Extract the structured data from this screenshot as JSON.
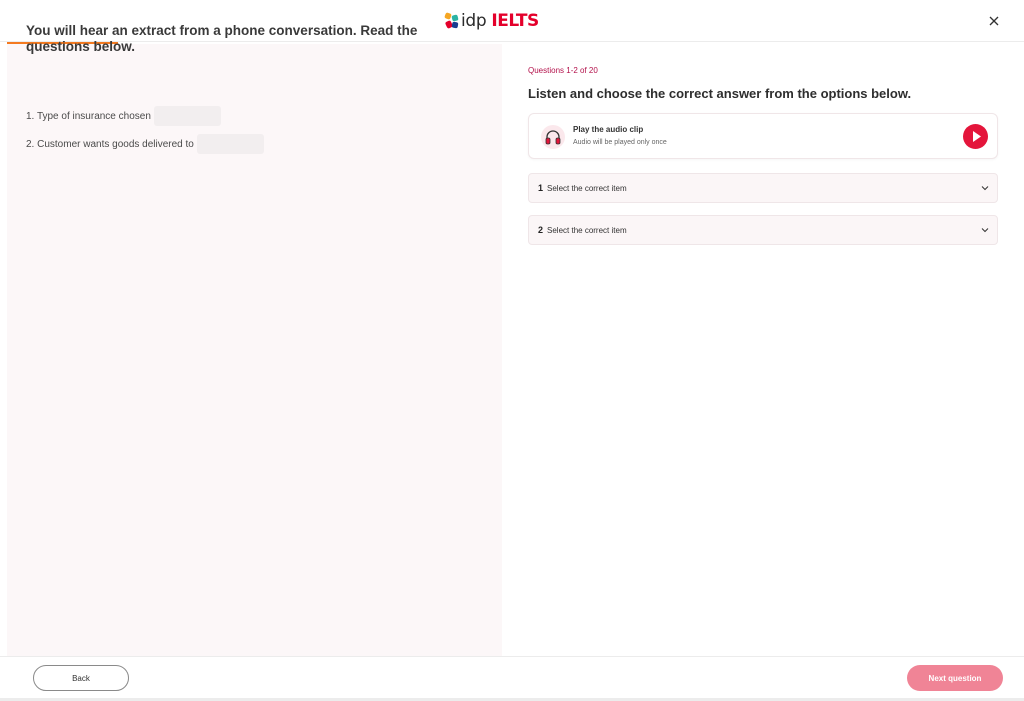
{
  "header": {
    "logo_idp": "idp",
    "logo_ielts": "IELTS"
  },
  "progress": {
    "fraction": 0.11
  },
  "left": {
    "intro": "You will hear an extract from a phone conversation. Read the questions below.",
    "questions": [
      {
        "text": "1. Type of insurance chosen",
        "value": ""
      },
      {
        "text": "2. Customer wants goods delivered to",
        "value": ""
      }
    ]
  },
  "right": {
    "question_count": "Questions 1-2 of 20",
    "instruction": "Listen and choose the correct answer from the options below.",
    "audio": {
      "title": "Play the audio clip",
      "subtitle": "Audio will be played only once"
    },
    "selects": [
      {
        "number": "1",
        "label": "Select the correct item"
      },
      {
        "number": "2",
        "label": "Select the correct item"
      }
    ]
  },
  "footer": {
    "back_label": "Back",
    "next_label": "Next question"
  },
  "icons": {
    "close": "close-icon",
    "headphones": "headphones-icon",
    "play": "play-icon",
    "chevron": "chevron-down-icon"
  },
  "colors": {
    "brand_red": "#e4002b",
    "progress_orange": "#f47a20",
    "accent_crimson": "#b3114b",
    "next_button": "#f08496"
  }
}
